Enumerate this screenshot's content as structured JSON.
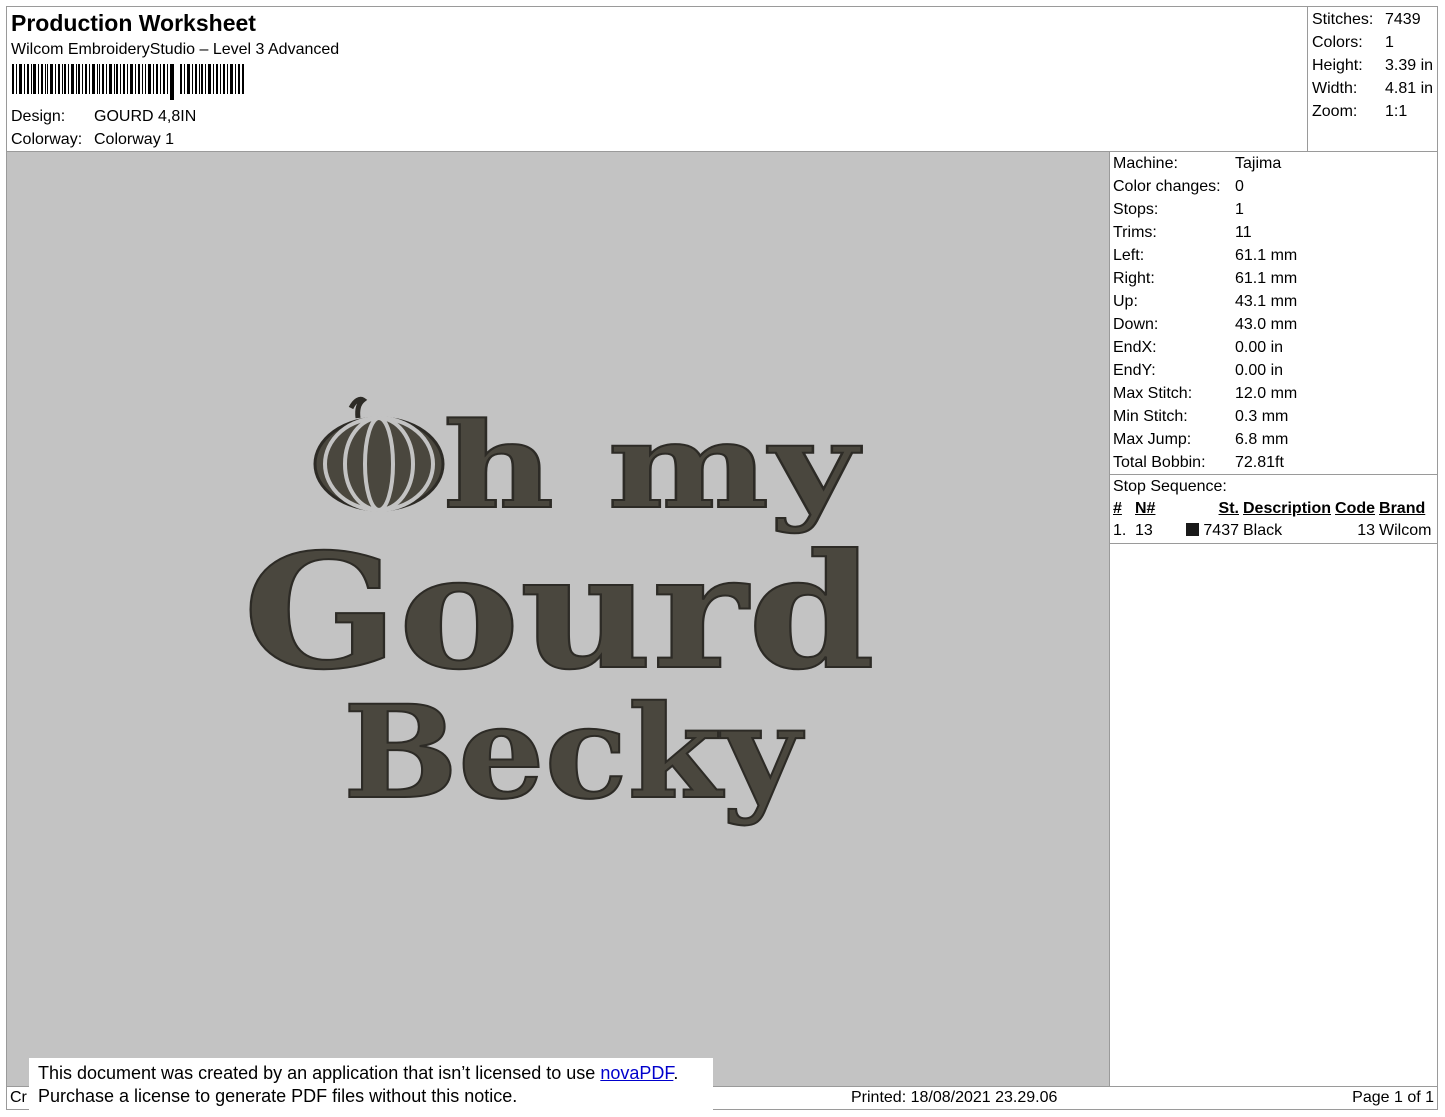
{
  "header": {
    "title": "Production Worksheet",
    "subtitle": "Wilcom EmbroideryStudio – Level 3 Advanced",
    "design_label": "Design:",
    "design_value": "GOURD 4,8IN",
    "colorway_label": "Colorway:",
    "colorway_value": "Colorway 1"
  },
  "summary": [
    {
      "label": "Stitches:",
      "value": "7439"
    },
    {
      "label": "Colors:",
      "value": "1"
    },
    {
      "label": "Height:",
      "value": "3.39 in"
    },
    {
      "label": "Width:",
      "value": "4.81 in"
    },
    {
      "label": "Zoom:",
      "value": "1:1"
    }
  ],
  "details": [
    {
      "label": "Machine:",
      "value": "Tajima"
    },
    {
      "label": "Color changes:",
      "value": "0"
    },
    {
      "label": "Stops:",
      "value": "1"
    },
    {
      "label": "Trims:",
      "value": "11"
    },
    {
      "label": "Left:",
      "value": "61.1 mm"
    },
    {
      "label": "Right:",
      "value": "61.1 mm"
    },
    {
      "label": "Up:",
      "value": "43.1 mm"
    },
    {
      "label": "Down:",
      "value": "43.0 mm"
    },
    {
      "label": "EndX:",
      "value": "0.00 in"
    },
    {
      "label": "EndY:",
      "value": "0.00 in"
    },
    {
      "label": "Max Stitch:",
      "value": "12.0 mm"
    },
    {
      "label": "Min Stitch:",
      "value": "0.3 mm"
    },
    {
      "label": "Max Jump:",
      "value": "6.8 mm"
    },
    {
      "label": "Total Bobbin:",
      "value": "72.81ft"
    }
  ],
  "stop_sequence": {
    "title": "Stop Sequence:",
    "columns": [
      "#",
      "N#",
      "St.",
      "Description",
      "Code",
      "Brand"
    ],
    "rows": [
      {
        "num": "1.",
        "n": "13",
        "st": "7437",
        "description": "Black",
        "code": "13",
        "brand": "Wilcom",
        "swatch_color": "#1a1a1a"
      }
    ]
  },
  "design_preview": {
    "line1_rest": "h my",
    "line2": "Gourd",
    "line3": "Becky",
    "thread_color": "#4a473e",
    "background_color": "#c3c3c3",
    "icon": "pumpkin-icon"
  },
  "footer": {
    "left_text": "Cr",
    "printed": "Printed: 18/08/2021 23.29.06",
    "page": "Page 1 of 1"
  },
  "notice": {
    "line1_prefix": "This document was created by an application that isn’t licensed to use ",
    "link_text": "novaPDF",
    "line1_suffix": ".",
    "line2": "Purchase a license to generate PDF files without this notice."
  }
}
